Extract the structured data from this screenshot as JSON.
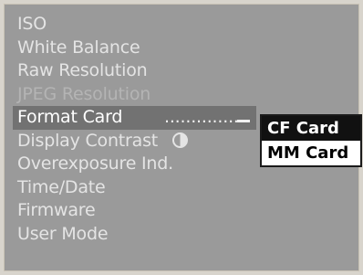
{
  "menu": {
    "items": [
      {
        "label": "ISO",
        "state": "enabled"
      },
      {
        "label": "White Balance",
        "state": "enabled"
      },
      {
        "label": "Raw Resolution",
        "state": "enabled"
      },
      {
        "label": "JPEG Resolution",
        "state": "disabled"
      },
      {
        "label": "Format Card",
        "state": "selected",
        "dots": "................",
        "icon": "submenu-arrow-icon"
      },
      {
        "label": "Display Contrast",
        "state": "enabled",
        "icon": "contrast-icon"
      },
      {
        "label": "Overexposure Ind.",
        "state": "enabled"
      },
      {
        "label": "Time/Date",
        "state": "enabled"
      },
      {
        "label": "Firmware",
        "state": "enabled"
      },
      {
        "label": "User Mode",
        "state": "enabled"
      }
    ]
  },
  "submenu": {
    "items": [
      {
        "label": "CF Card",
        "selected": true
      },
      {
        "label": "MM Card",
        "selected": false
      }
    ]
  },
  "colors": {
    "panel": "#9a9a9a",
    "selection": "#727272",
    "text": "#e4e4e4",
    "disabled_text": "#b4b4b4",
    "submenu_bg": "#ffffff",
    "submenu_selection": "#111111"
  }
}
